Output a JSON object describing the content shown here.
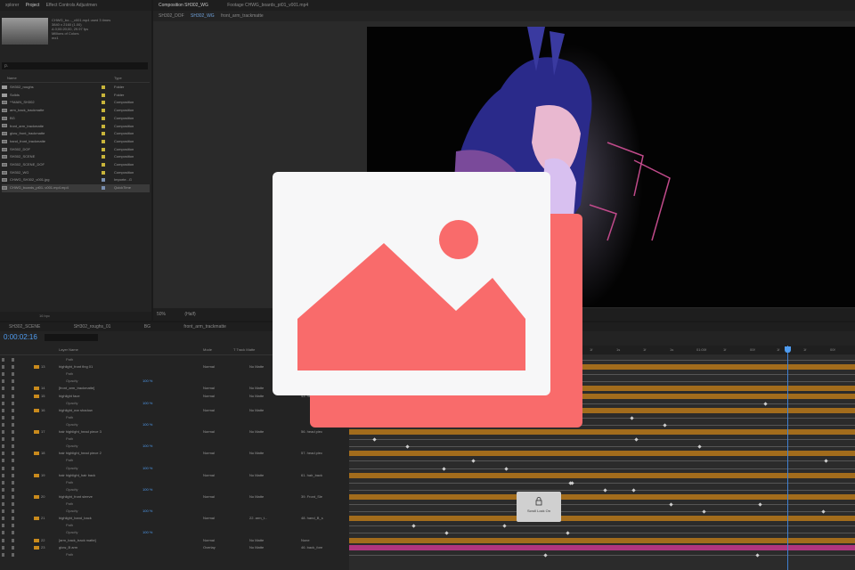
{
  "project_panel": {
    "tabs": [
      "xplorer",
      "Project",
      "Effect Controls Adjustmen"
    ],
    "selected_file": {
      "name": "CHWG_bo..._v001.mp4",
      "used": "used 3 times",
      "line1": "3840 x 2160 (1.00)",
      "line2": "Δ 0;00:20;00, 29.97 fps",
      "line3": "Millions of Colors",
      "line4": "mx1"
    },
    "search_placeholder": "ρ.",
    "columns": {
      "name": "Name",
      "type": "Type"
    },
    "items": [
      {
        "name": "SH302_roughs",
        "type": "Folder",
        "icon": "folder-icon",
        "swatch": "#c8b43a"
      },
      {
        "name": "Solids",
        "type": "Folder",
        "icon": "folder-icon",
        "swatch": "#c8b43a"
      },
      {
        "name": "**MAIN_SH302",
        "type": "Composition",
        "icon": "composition-icon",
        "swatch": "#c8b43a"
      },
      {
        "name": "arm_back_trackmatte",
        "type": "Composition",
        "icon": "composition-icon",
        "swatch": "#c8b43a"
      },
      {
        "name": "BG",
        "type": "Composition",
        "icon": "composition-icon",
        "swatch": "#c8b43a"
      },
      {
        "name": "front_arm_trackmatte",
        "type": "Composition",
        "icon": "composition-icon",
        "swatch": "#c8b43a"
      },
      {
        "name": "glow_front_trackmatte",
        "type": "Composition",
        "icon": "composition-icon",
        "swatch": "#c8b43a"
      },
      {
        "name": "hand_front_trackmatte",
        "type": "Composition",
        "icon": "composition-icon",
        "swatch": "#c8b43a"
      },
      {
        "name": "SH302_DOF",
        "type": "Composition",
        "icon": "composition-icon",
        "swatch": "#c8b43a"
      },
      {
        "name": "SH302_SCENE",
        "type": "Composition",
        "icon": "composition-icon",
        "swatch": "#c8b43a"
      },
      {
        "name": "SH302_SCENE_DOF",
        "type": "Composition",
        "icon": "composition-icon",
        "swatch": "#c8b43a"
      },
      {
        "name": "SH302_WG",
        "type": "Composition",
        "icon": "composition-icon",
        "swatch": "#c8b43a"
      },
      {
        "name": "CHWG_SH302_v001.jpg",
        "type": "Importe...G",
        "icon": "image-file-icon",
        "swatch": "#7a8fb0"
      },
      {
        "name": "CHWG_boards_pt01..v001.mp4.mp4",
        "type": "QuickTime",
        "icon": "video-file-icon",
        "swatch": "#7a8fb0"
      }
    ],
    "bottom_label": "16 bpc"
  },
  "viewer": {
    "tabs": [
      "Composition SH302_WG",
      "Footage CHWG_boards_pt01_v001.mp4"
    ],
    "subtabs": [
      "SH302_DOF",
      "SH302_WG",
      "front_arm_trackmatte"
    ],
    "zoom": "50%",
    "resolution": "(Half)"
  },
  "timeline": {
    "tabs": [
      "SH302_SCENE",
      "SH302_roughs_01",
      "BG",
      "front_arm_trackmatte"
    ],
    "timecode": "0:00:02:16",
    "headers": {
      "layer_name": "Layer Name",
      "mode": "Mode",
      "track_matte": "T  Track Matte"
    },
    "ruler": [
      "1f",
      "1s",
      "1f",
      "1s",
      "01:00f",
      "1f",
      "00f",
      "1f",
      "1f",
      "00f"
    ],
    "layers": [
      {
        "kind": "sub",
        "name": "Path"
      },
      {
        "kind": "layer",
        "num": "13",
        "name": "highlight_front fing 01",
        "mode": "Normal",
        "matte": "No Matte",
        "parent": "14. front_..."
      },
      {
        "kind": "sub",
        "name": "Path"
      },
      {
        "kind": "sub",
        "name": "Opacity",
        "stat": "100 %"
      },
      {
        "kind": "layer",
        "num": "14",
        "name": "[front_arm_trackmatte]",
        "mode": "Normal",
        "matte": "No Matte",
        "parent": ""
      },
      {
        "kind": "layer",
        "num": "15",
        "name": "highlight face",
        "mode": "Normal",
        "matte": "No Matte",
        "parent": "43. head..."
      },
      {
        "kind": "sub",
        "name": "Opacity",
        "stat": "100 %"
      },
      {
        "kind": "layer",
        "num": "16",
        "name": "highlight_ear shadow",
        "mode": "Normal",
        "matte": "No Matte",
        "parent": ""
      },
      {
        "kind": "sub",
        "name": "Path"
      },
      {
        "kind": "sub",
        "name": "Opacity",
        "stat": "100 %"
      },
      {
        "kind": "layer",
        "num": "17",
        "name": "hair highlight_head piece 3",
        "mode": "Normal",
        "matte": "No Matte",
        "parent": "56. head piec"
      },
      {
        "kind": "sub",
        "name": "Path"
      },
      {
        "kind": "sub",
        "name": "Opacity",
        "stat": "100 %"
      },
      {
        "kind": "layer",
        "num": "18",
        "name": "hair highlight_head piece 2",
        "mode": "Normal",
        "matte": "No Matte",
        "parent": "57. head piec"
      },
      {
        "kind": "sub",
        "name": "Path"
      },
      {
        "kind": "sub",
        "name": "Opacity",
        "stat": "100 %"
      },
      {
        "kind": "layer",
        "num": "19",
        "name": "hair highlight_hair back",
        "mode": "Normal",
        "matte": "No Matte",
        "parent": "61. hair_back"
      },
      {
        "kind": "sub",
        "name": "Path"
      },
      {
        "kind": "sub",
        "name": "Opacity",
        "stat": "100 %"
      },
      {
        "kind": "layer",
        "num": "20",
        "name": "highlight_front sleeve",
        "mode": "Normal",
        "matte": "No Matte",
        "parent": "39. Front_Sle"
      },
      {
        "kind": "sub",
        "name": "Path"
      },
      {
        "kind": "sub",
        "name": "Opacity",
        "stat": "100 %"
      },
      {
        "kind": "layer",
        "num": "21",
        "name": "highlight_hand_back",
        "mode": "Normal",
        "matte": "22. arm_t...",
        "parent": "48. hand_B_s"
      },
      {
        "kind": "sub",
        "name": "Path"
      },
      {
        "kind": "sub",
        "name": "Opacity",
        "stat": "100 %"
      },
      {
        "kind": "layer",
        "num": "22",
        "name": "[arm_back_track matte]",
        "mode": "Normal",
        "matte": "No Matte",
        "parent": "None"
      },
      {
        "kind": "layer",
        "num": "23",
        "name": "glow_B arm",
        "mode": "Overlay",
        "matte": "No Matte",
        "parent": "46. back_fore"
      },
      {
        "kind": "sub",
        "name": "Path"
      }
    ],
    "tooltip": "Scroll Lock On"
  },
  "colors": {
    "accent": "#4f9cf0",
    "layer_bar": "#a26c1c",
    "placeholder_red": "#f96b6b",
    "placeholder_bg": "#f7f7f8"
  }
}
